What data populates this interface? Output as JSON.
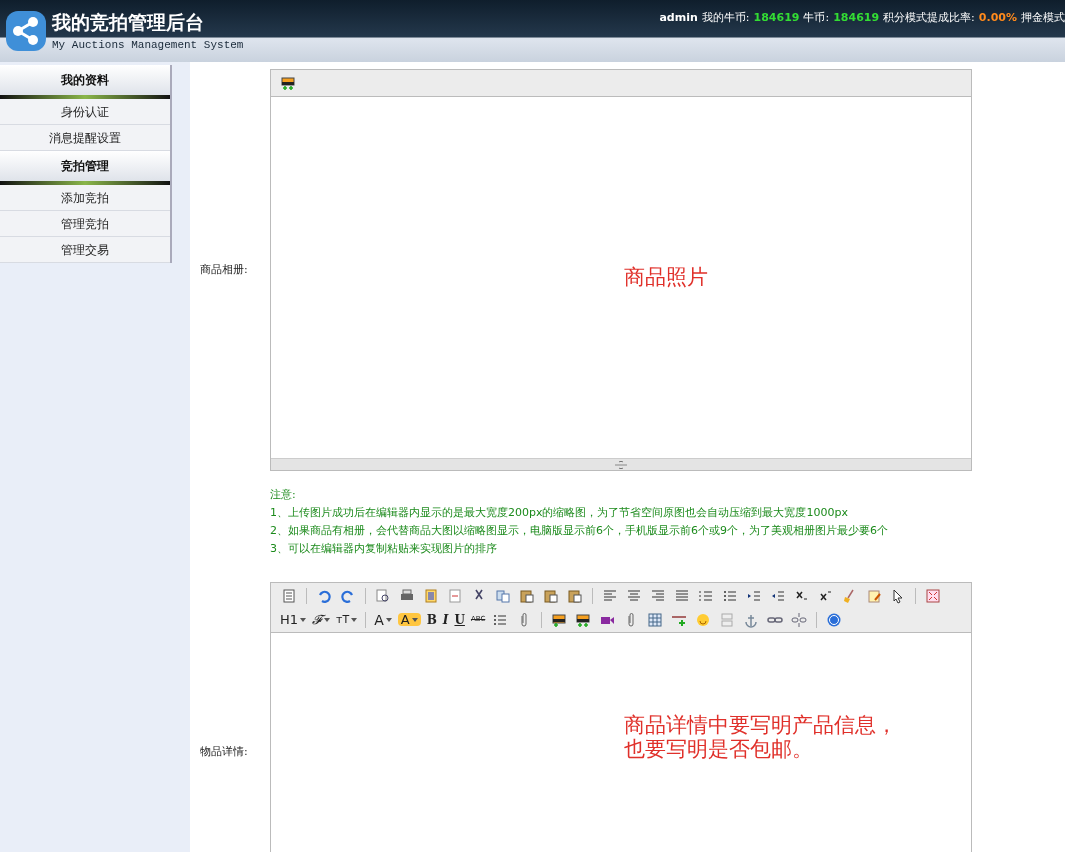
{
  "header": {
    "title": "我的竞拍管理后台",
    "subtitle": "My Auctions Management System",
    "username": "admin",
    "stats": [
      {
        "label": "我的牛币:",
        "value": "184619",
        "color": "#33dd33"
      },
      {
        "label": "牛币:",
        "value": "184619",
        "color": "#33dd33"
      },
      {
        "label": "积分模式提成比率:",
        "value": "0.00%",
        "color": "#ff8a1c"
      },
      {
        "label": "押金模式"
      }
    ]
  },
  "sidebar": {
    "groups": [
      {
        "heading": "我的资料",
        "items": [
          "身份认证",
          "消息提醒设置"
        ]
      },
      {
        "heading": "竞拍管理",
        "items": [
          "添加竞拍",
          "管理竞拍",
          "管理交易"
        ]
      }
    ]
  },
  "form": {
    "album": {
      "label": "商品相册:",
      "content": "商品照片",
      "notes": [
        "注意:",
        "1、上传图片成功后在编辑器内显示的是最大宽度200px的缩略图，为了节省空间原图也会自动压缩到最大宽度1000px",
        "2、如果商品有相册，会代替商品大图以缩略图显示，电脑版显示前6个，手机版显示前6个或9个，为了美观相册图片最少要6个",
        "3、可以在编辑器内复制粘贴来实现图片的排序"
      ]
    },
    "details": {
      "label": "物品详情:",
      "toolbar_labels": [
        "H1",
        "𝓕",
        "тT",
        "A",
        "A",
        "B",
        "I",
        "U",
        "ABC"
      ],
      "content": [
        "商品详情中要写明产品信息，",
        "也要写明是否包邮。"
      ]
    }
  }
}
